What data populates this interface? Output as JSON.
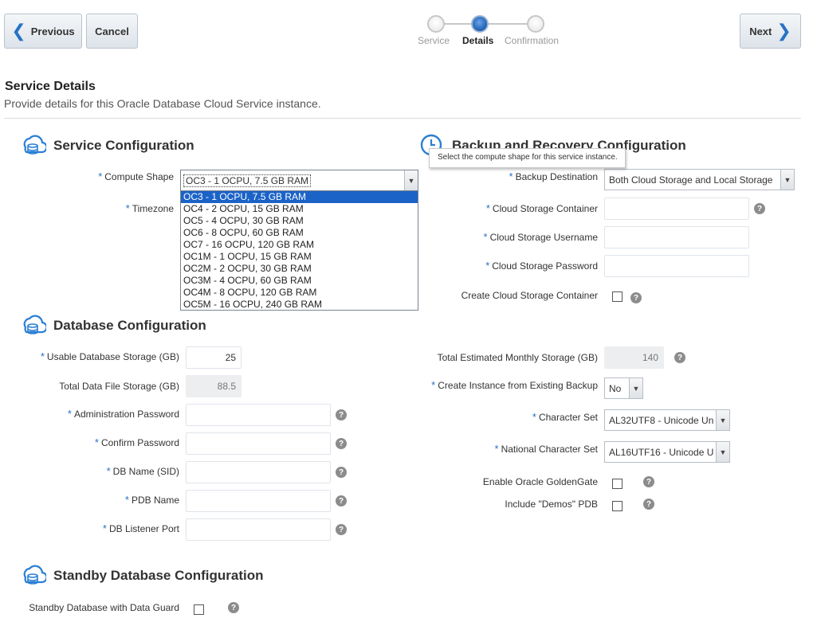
{
  "nav": {
    "previous": "Previous",
    "cancel": "Cancel",
    "next": "Next"
  },
  "train": {
    "steps": [
      "Service",
      "Details",
      "Confirmation"
    ],
    "active": "Details"
  },
  "page": {
    "title": "Service Details",
    "subtitle": "Provide details for this Oracle Database Cloud Service instance."
  },
  "service_config": {
    "heading": "Service Configuration",
    "compute_shape_label": "Compute Shape",
    "compute_shape_value": "OC3 - 1 OCPU, 7.5 GB RAM",
    "compute_shape_options": [
      "OC3 - 1 OCPU, 7.5 GB RAM",
      "OC4 - 2 OCPU, 15 GB RAM",
      "OC5 - 4 OCPU, 30 GB RAM",
      "OC6 - 8 OCPU, 60 GB RAM",
      "OC7 - 16 OCPU, 120 GB RAM",
      "OC1M - 1 OCPU, 15 GB RAM",
      "OC2M - 2 OCPU, 30 GB RAM",
      "OC3M - 4 OCPU, 60 GB RAM",
      "OC4M - 8 OCPU, 120 GB RAM",
      "OC5M - 16 OCPU, 240 GB RAM"
    ],
    "timezone_label": "Timezone",
    "tooltip": "Select the compute shape for this service instance."
  },
  "backup_config": {
    "heading": "Backup and Recovery Configuration",
    "backup_destination_label": "Backup Destination",
    "backup_destination_value": "Both Cloud Storage and Local Storage",
    "container_label": "Cloud Storage Container",
    "username_label": "Cloud Storage Username",
    "password_label": "Cloud Storage Password",
    "create_container_label": "Create Cloud Storage Container"
  },
  "database_config": {
    "heading": "Database Configuration",
    "usable_storage_label": "Usable Database Storage (GB)",
    "usable_storage_value": "25",
    "total_data_label": "Total Data File Storage (GB)",
    "total_data_value": "88.5",
    "admin_password_label": "Administration Password",
    "confirm_password_label": "Confirm Password",
    "db_name_label": "DB Name (SID)",
    "pdb_name_label": "PDB Name",
    "listener_port_label": "DB Listener Port",
    "monthly_storage_label": "Total Estimated Monthly Storage (GB)",
    "monthly_storage_value": "140",
    "from_backup_label": "Create Instance from Existing Backup",
    "from_backup_value": "No",
    "charset_label": "Character Set",
    "charset_value": "AL32UTF8 - Unicode Un",
    "ncharset_label": "National Character Set",
    "ncharset_value": "AL16UTF16 - Unicode U",
    "goldengate_label": "Enable Oracle GoldenGate",
    "demos_label": "Include \"Demos\" PDB"
  },
  "standby_config": {
    "heading": "Standby Database Configuration",
    "dataguard_label": "Standby Database with Data Guard"
  },
  "help_glyph": "?",
  "required_glyph": "*"
}
